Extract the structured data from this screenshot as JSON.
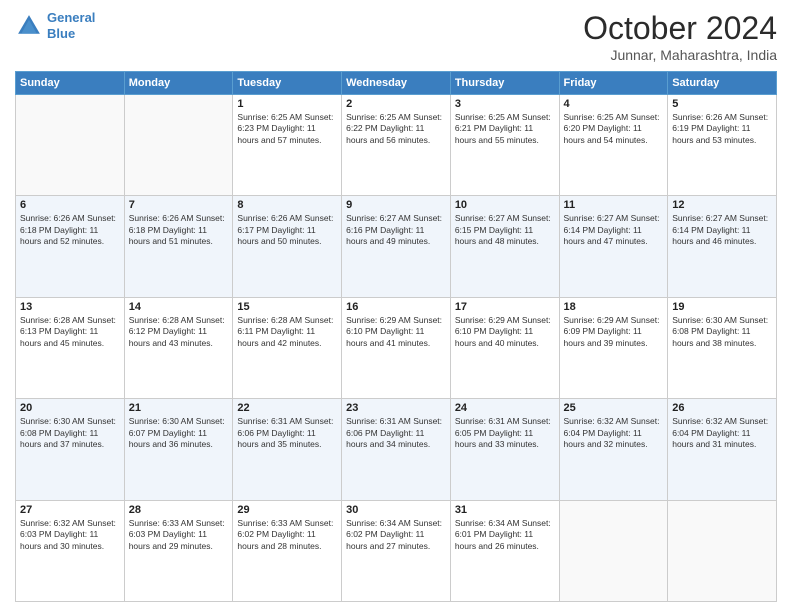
{
  "header": {
    "logo_line1": "General",
    "logo_line2": "Blue",
    "title": "October 2024",
    "location": "Junnar, Maharashtra, India"
  },
  "days_of_week": [
    "Sunday",
    "Monday",
    "Tuesday",
    "Wednesday",
    "Thursday",
    "Friday",
    "Saturday"
  ],
  "weeks": [
    [
      {
        "day": "",
        "info": ""
      },
      {
        "day": "",
        "info": ""
      },
      {
        "day": "1",
        "info": "Sunrise: 6:25 AM\nSunset: 6:23 PM\nDaylight: 11 hours and 57 minutes."
      },
      {
        "day": "2",
        "info": "Sunrise: 6:25 AM\nSunset: 6:22 PM\nDaylight: 11 hours and 56 minutes."
      },
      {
        "day": "3",
        "info": "Sunrise: 6:25 AM\nSunset: 6:21 PM\nDaylight: 11 hours and 55 minutes."
      },
      {
        "day": "4",
        "info": "Sunrise: 6:25 AM\nSunset: 6:20 PM\nDaylight: 11 hours and 54 minutes."
      },
      {
        "day": "5",
        "info": "Sunrise: 6:26 AM\nSunset: 6:19 PM\nDaylight: 11 hours and 53 minutes."
      }
    ],
    [
      {
        "day": "6",
        "info": "Sunrise: 6:26 AM\nSunset: 6:18 PM\nDaylight: 11 hours and 52 minutes."
      },
      {
        "day": "7",
        "info": "Sunrise: 6:26 AM\nSunset: 6:18 PM\nDaylight: 11 hours and 51 minutes."
      },
      {
        "day": "8",
        "info": "Sunrise: 6:26 AM\nSunset: 6:17 PM\nDaylight: 11 hours and 50 minutes."
      },
      {
        "day": "9",
        "info": "Sunrise: 6:27 AM\nSunset: 6:16 PM\nDaylight: 11 hours and 49 minutes."
      },
      {
        "day": "10",
        "info": "Sunrise: 6:27 AM\nSunset: 6:15 PM\nDaylight: 11 hours and 48 minutes."
      },
      {
        "day": "11",
        "info": "Sunrise: 6:27 AM\nSunset: 6:14 PM\nDaylight: 11 hours and 47 minutes."
      },
      {
        "day": "12",
        "info": "Sunrise: 6:27 AM\nSunset: 6:14 PM\nDaylight: 11 hours and 46 minutes."
      }
    ],
    [
      {
        "day": "13",
        "info": "Sunrise: 6:28 AM\nSunset: 6:13 PM\nDaylight: 11 hours and 45 minutes."
      },
      {
        "day": "14",
        "info": "Sunrise: 6:28 AM\nSunset: 6:12 PM\nDaylight: 11 hours and 43 minutes."
      },
      {
        "day": "15",
        "info": "Sunrise: 6:28 AM\nSunset: 6:11 PM\nDaylight: 11 hours and 42 minutes."
      },
      {
        "day": "16",
        "info": "Sunrise: 6:29 AM\nSunset: 6:10 PM\nDaylight: 11 hours and 41 minutes."
      },
      {
        "day": "17",
        "info": "Sunrise: 6:29 AM\nSunset: 6:10 PM\nDaylight: 11 hours and 40 minutes."
      },
      {
        "day": "18",
        "info": "Sunrise: 6:29 AM\nSunset: 6:09 PM\nDaylight: 11 hours and 39 minutes."
      },
      {
        "day": "19",
        "info": "Sunrise: 6:30 AM\nSunset: 6:08 PM\nDaylight: 11 hours and 38 minutes."
      }
    ],
    [
      {
        "day": "20",
        "info": "Sunrise: 6:30 AM\nSunset: 6:08 PM\nDaylight: 11 hours and 37 minutes."
      },
      {
        "day": "21",
        "info": "Sunrise: 6:30 AM\nSunset: 6:07 PM\nDaylight: 11 hours and 36 minutes."
      },
      {
        "day": "22",
        "info": "Sunrise: 6:31 AM\nSunset: 6:06 PM\nDaylight: 11 hours and 35 minutes."
      },
      {
        "day": "23",
        "info": "Sunrise: 6:31 AM\nSunset: 6:06 PM\nDaylight: 11 hours and 34 minutes."
      },
      {
        "day": "24",
        "info": "Sunrise: 6:31 AM\nSunset: 6:05 PM\nDaylight: 11 hours and 33 minutes."
      },
      {
        "day": "25",
        "info": "Sunrise: 6:32 AM\nSunset: 6:04 PM\nDaylight: 11 hours and 32 minutes."
      },
      {
        "day": "26",
        "info": "Sunrise: 6:32 AM\nSunset: 6:04 PM\nDaylight: 11 hours and 31 minutes."
      }
    ],
    [
      {
        "day": "27",
        "info": "Sunrise: 6:32 AM\nSunset: 6:03 PM\nDaylight: 11 hours and 30 minutes."
      },
      {
        "day": "28",
        "info": "Sunrise: 6:33 AM\nSunset: 6:03 PM\nDaylight: 11 hours and 29 minutes."
      },
      {
        "day": "29",
        "info": "Sunrise: 6:33 AM\nSunset: 6:02 PM\nDaylight: 11 hours and 28 minutes."
      },
      {
        "day": "30",
        "info": "Sunrise: 6:34 AM\nSunset: 6:02 PM\nDaylight: 11 hours and 27 minutes."
      },
      {
        "day": "31",
        "info": "Sunrise: 6:34 AM\nSunset: 6:01 PM\nDaylight: 11 hours and 26 minutes."
      },
      {
        "day": "",
        "info": ""
      },
      {
        "day": "",
        "info": ""
      }
    ]
  ]
}
